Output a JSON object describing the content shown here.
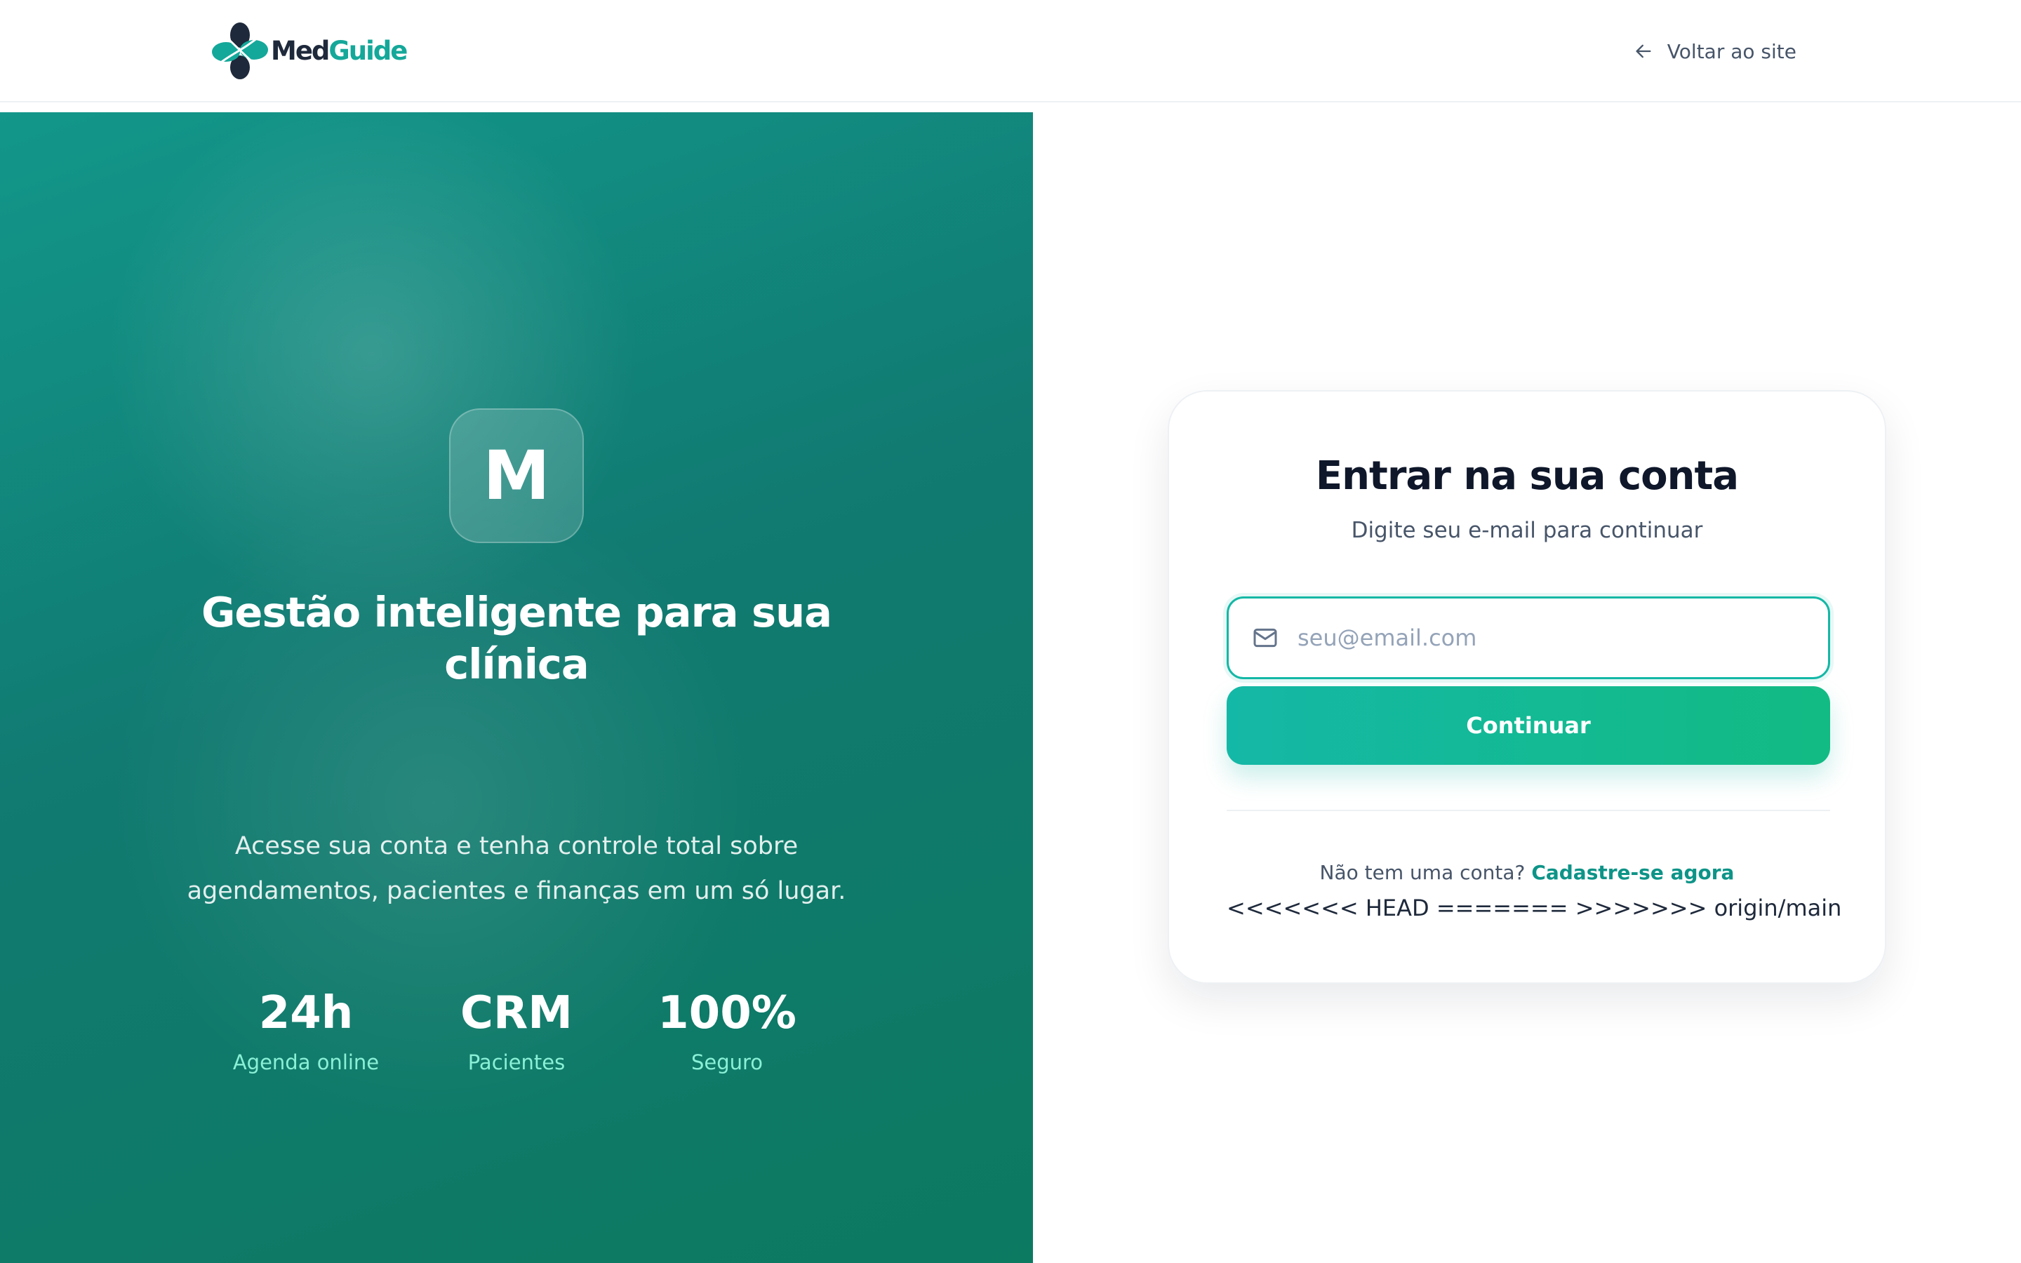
{
  "header": {
    "brand": {
      "part1": "Med",
      "part2": "Guide"
    },
    "back_link": "Voltar ao site",
    "icons": {
      "logo": "medguide-logo-icon",
      "back": "arrow-left-icon"
    }
  },
  "hero": {
    "badge_letter": "M",
    "title": "Gestão inteligente para sua clínica",
    "description": "Acesse sua conta e tenha controle total sobre agendamentos, pacientes e finanças em um só lugar.",
    "stats": [
      {
        "value": "24h",
        "label": "Agenda online"
      },
      {
        "value": "CRM",
        "label": "Pacientes"
      },
      {
        "value": "100%",
        "label": "Seguro"
      }
    ]
  },
  "login": {
    "title": "Entrar na sua conta",
    "subtitle": "Digite seu e-mail para continuar",
    "email": {
      "placeholder": "seu@email.com",
      "value": "",
      "icon": "mail-icon"
    },
    "submit_label": "Continuar",
    "signup_prompt": "Não tem uma conta?",
    "signup_link": "Cadastre-se agora",
    "merge_marker": "<<<<<<< HEAD ======= >>>>>>> origin/main"
  },
  "colors": {
    "accent": "#14b8a6",
    "accent_dark": "#0d9488",
    "hero_green": "#117a71",
    "button_end": "#12bb83",
    "text_dark": "#0f172a",
    "text_muted": "#475569"
  }
}
